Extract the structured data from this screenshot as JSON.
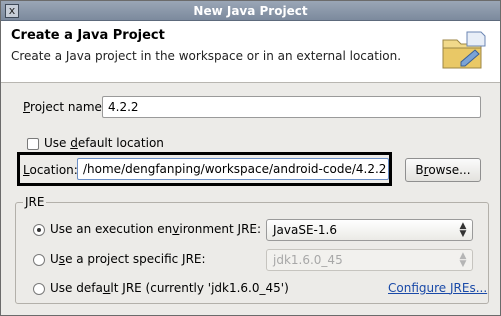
{
  "window": {
    "title": "New Java Project",
    "close_glyph": "x"
  },
  "header": {
    "title": "Create a Java Project",
    "subtitle": "Create a Java project in the workspace or in an external location.",
    "icon": "folder-icon"
  },
  "project_name": {
    "label_pre": "",
    "label_mnemonic": "P",
    "label_post": "roject name:",
    "value": "4.2.2"
  },
  "default_location": {
    "label_pre": "Use ",
    "label_mnemonic": "d",
    "label_post": "efault location",
    "checked": false
  },
  "location": {
    "label_pre": "",
    "label_mnemonic": "L",
    "label_post": "ocation:",
    "value": "/home/dengfanping/workspace/android-code/4.2.2",
    "browse_pre": "B",
    "browse_mnemonic": "r",
    "browse_post": "owse..."
  },
  "jre": {
    "group_title": "JRE",
    "options": [
      {
        "pre": "Use an execution en",
        "mnemonic": "v",
        "post": "ironment JRE:",
        "checked": true
      },
      {
        "pre": "U",
        "mnemonic": "s",
        "post": "e a project specific JRE:",
        "checked": false
      },
      {
        "pre": "Use defa",
        "mnemonic": "u",
        "post": "lt JRE (currently 'jdk1.6.0_45')",
        "checked": false
      }
    ],
    "env_select_value": "JavaSE-1.6",
    "specific_select_value": "jdk1.6.0_45",
    "configure_link_pre": "Configure ",
    "configure_link_mnemonic": "J",
    "configure_link_post": "REs..."
  }
}
